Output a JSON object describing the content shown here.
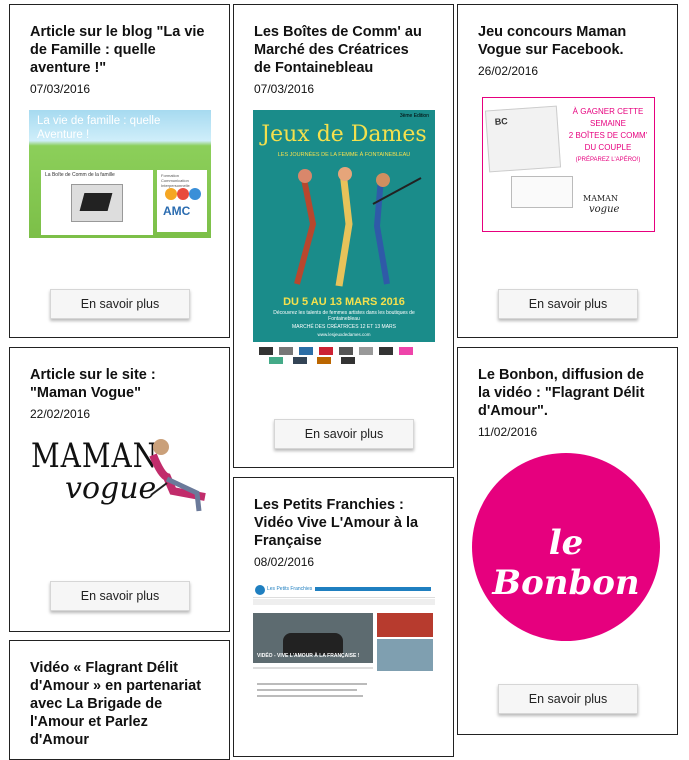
{
  "cta_label": "En savoir plus",
  "cards": [
    {
      "title_lines": [
        "Article sur le blog \"La vie",
        "de Famille : quelle",
        "aventure !\""
      ],
      "date": "07/03/2016",
      "image": {
        "headline": "La vie de famille : quelle Aventure !",
        "post_title": "La Boîte de Comm de la famille",
        "logo_text": "AMC",
        "logo_sub": "Formation Communication Interpersonnelle"
      }
    },
    {
      "title_lines": [
        "Les Boîtes de Comm' au",
        "Marché des Créatrices",
        "de Fontainebleau"
      ],
      "date": "07/03/2016",
      "image": {
        "edition": "3ème Edition",
        "headline": "Jeux de Dames",
        "subtitle": "LES JOURNÉES DE LA FEMME À FONTAINEBLEAU",
        "dates": "DU 5 AU 13 MARS 2016",
        "tagline": "Découvrez les talents de femmes artistes dans les boutiques de Fontainebleau",
        "market": "MARCHÉ DES CRÉATRICES 12 ET 13 MARS",
        "url": "www.lesjeuxdedames.com"
      }
    },
    {
      "title_lines": [
        "Jeu concours Maman",
        "Vogue sur Facebook."
      ],
      "date": "26/02/2016",
      "image": {
        "lines": [
          "À GAGNER CETTE SEMAINE",
          "2 BOÎTES DE COMM'",
          "DU COUPLE"
        ],
        "aside": "(PRÉPAREZ L'APÉRO!)",
        "brand_top": "MAMAN",
        "brand_bottom": "vogue"
      }
    },
    {
      "title_lines": [
        "Article sur le site :",
        "\"Maman Vogue\""
      ],
      "date": "22/02/2016",
      "image": {
        "brand_top": "MAMAN",
        "brand_bottom": "vogue"
      }
    },
    {
      "title_lines": [
        "Les Petits Franchies :",
        "Vidéo Vive L'Amour à la",
        "Française"
      ],
      "date": "08/02/2016",
      "image": {
        "site": "Les Petits Franchies",
        "caption": "VIDÉO - VIVE L'AMOUR À LA FRANÇAISE !"
      }
    },
    {
      "title_lines": [
        "Le Bonbon, diffusion de",
        "la vidéo : \"Flagrant Délit",
        "d'Amour\"."
      ],
      "date": "11/02/2016",
      "image": {
        "logo": "le Bonbon"
      }
    },
    {
      "title_lines": [
        "Vidéo « Flagrant Délit",
        "d'Amour » en partenariat",
        "avec La Brigade de",
        "l'Amour et Parlez",
        "d'Amour"
      ]
    }
  ],
  "colors": {
    "pink": "#e6007e",
    "teal": "#1a8c8a",
    "maman_pink": "#e0127a"
  }
}
